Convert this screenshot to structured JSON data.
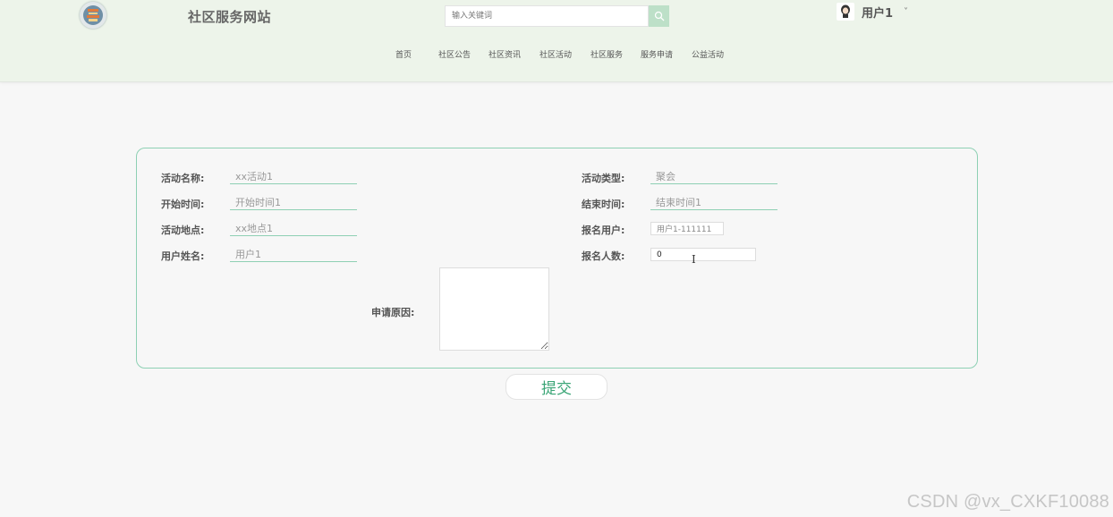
{
  "header": {
    "site_title": "社区服务网站",
    "logo_icon": "temple-logo-icon",
    "search": {
      "placeholder": "输入关键词",
      "value": "",
      "button_icon": "search-icon"
    },
    "user": {
      "name": "用户1",
      "caret": "˅",
      "avatar_icon": "user-avatar-icon"
    }
  },
  "nav": {
    "items": [
      {
        "label": "首页"
      },
      {
        "label": "社区公告"
      },
      {
        "label": "社区资讯"
      },
      {
        "label": "社区活动"
      },
      {
        "label": "社区服务"
      },
      {
        "label": "服务申请"
      },
      {
        "label": "公益活动"
      }
    ]
  },
  "form": {
    "activity_name": {
      "label": "活动名称:",
      "value": "xx活动1"
    },
    "activity_type": {
      "label": "活动类型:",
      "value": "聚会"
    },
    "start_time": {
      "label": "开始时间:",
      "value": "开始时间1"
    },
    "end_time": {
      "label": "结束时间:",
      "value": "结束时间1"
    },
    "location": {
      "label": "活动地点:",
      "value": "xx地点1"
    },
    "signup_user": {
      "label": "报名用户:",
      "value": "用户1-111111"
    },
    "user_name": {
      "label": "用户姓名:",
      "value": "用户1"
    },
    "signup_count": {
      "label": "报名人数:",
      "value": "0"
    },
    "reason": {
      "label": "申请原因:",
      "value": ""
    },
    "submit_label": "提交"
  },
  "cursor_glyph": "I",
  "watermark": "CSDN @vx_CXKF10088",
  "colors": {
    "header_bg": "#edf4ea",
    "accent_green": "#3aa576",
    "border_green": "#8ed0b4",
    "page_bg": "#f7f7f7"
  }
}
